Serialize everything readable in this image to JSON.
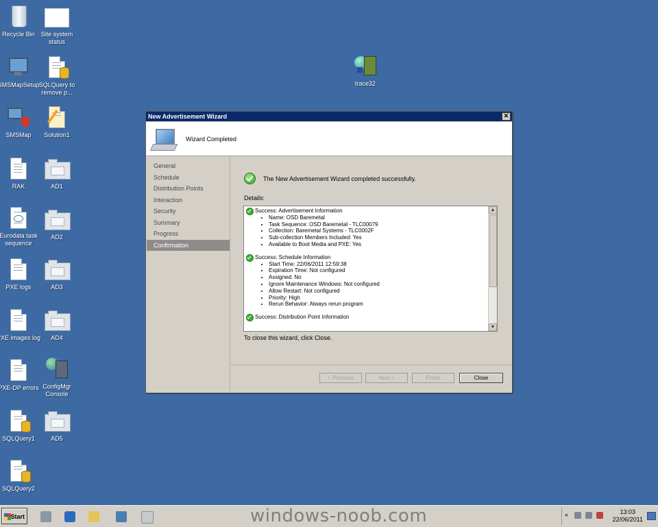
{
  "desktop": {
    "icons": [
      {
        "label": "Recycle Bin",
        "icon": "recycle-bin-icon"
      },
      {
        "label": "Site system status",
        "icon": "blank-document-icon"
      },
      {
        "label": "SMSMapSetup",
        "icon": "setup-computer-icon"
      },
      {
        "label": "SQLQuery to remove p...",
        "icon": "sql-document-icon"
      },
      {
        "label": "SMSMap",
        "icon": "network-map-icon"
      },
      {
        "label": "Solution1",
        "icon": "solution-document-icon"
      },
      {
        "label": "RAK",
        "icon": "document-icon"
      },
      {
        "label": "AD1",
        "icon": "folder-icon"
      },
      {
        "label": "Eurodata task sequence",
        "icon": "xml-document-icon"
      },
      {
        "label": "AD2",
        "icon": "folder-icon"
      },
      {
        "label": "PXE logs",
        "icon": "document-icon"
      },
      {
        "label": "AD3",
        "icon": "folder-icon"
      },
      {
        "label": "PXE images log",
        "icon": "document-icon"
      },
      {
        "label": "AD4",
        "icon": "folder-icon"
      },
      {
        "label": "PXE-DP errors",
        "icon": "document-icon"
      },
      {
        "label": "ConfigMgr Console",
        "icon": "configmgr-console-icon"
      },
      {
        "label": "SQLQuery1",
        "icon": "sql-document-icon"
      },
      {
        "label": "AD5",
        "icon": "folder-icon"
      },
      {
        "label": "SQLQuery2",
        "icon": "sql-document-icon"
      },
      {
        "label": "trace32",
        "icon": "trace32-icon"
      }
    ]
  },
  "wizard": {
    "title": "New Advertisement Wizard",
    "close_glyph": "✕",
    "header_title": "Wizard Completed",
    "nav": [
      "General",
      "Schedule",
      "Distribution Points",
      "Interaction",
      "Security",
      "Summary",
      "Progress",
      "Confirmation"
    ],
    "active_nav": "Confirmation",
    "success_message": "The New Advertisement Wizard completed successfully.",
    "details_label": "Details:",
    "details": [
      {
        "heading": "Success: Advertisement Information",
        "items": [
          "Name: OSD Baremetal",
          "Task Sequence: OSD Baremetal - TLC00079",
          "Collection: Baremetal Systems - TLC0002F",
          "Sub-collection Members Included: Yes",
          "Available to Boot Media and PXE: Yes"
        ]
      },
      {
        "heading": "Success: Schedule Information",
        "items": [
          "Start Time: 22/06/2011 12:59:38",
          "Expiration Time: Not configured",
          "Assigned: No",
          "Ignore Maintenance Windows: Not configured",
          "Allow Restart: Not configured",
          "Priority: High",
          "Rerun Behavior: Always rerun program"
        ]
      },
      {
        "heading": "Success: Distribution Point Information",
        "items": []
      }
    ],
    "close_hint": "To close this wizard, click Close.",
    "buttons": {
      "previous": "< Previous",
      "next": "Next >",
      "finish": "Finish",
      "close": "Close"
    },
    "scroll_up": "▲",
    "scroll_down": "▼"
  },
  "taskbar": {
    "start_label": "Start",
    "watermark": "windows-noob.com",
    "tray_chevron": "«",
    "time": "13:03",
    "date": "22/06/2011"
  }
}
